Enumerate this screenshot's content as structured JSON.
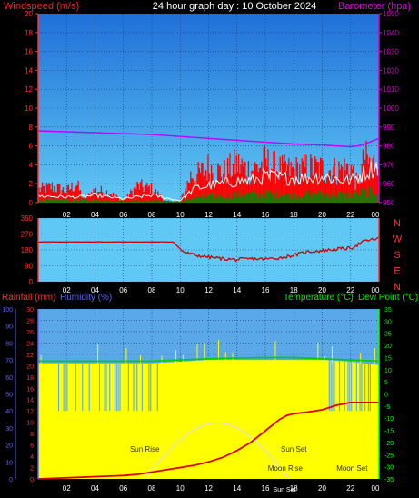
{
  "header": {
    "left_label": "Windspeed (m/s)",
    "title": "24 hour graph day : 10 October 2024",
    "right_label": "Barometer (hpa)"
  },
  "colors": {
    "wind_label": "#ff2020",
    "title": "#ffffff",
    "baro_label": "#e000e0",
    "tick": "#ffffff",
    "wind_axis": "#ff3030",
    "baro_axis": "#d000d0",
    "dir_axis": "#ff3030",
    "rain_axis": "#6060ff",
    "temp_axis": "#00ff00",
    "wind_bg_top": "#2070d8",
    "wind_bg_bottom": "#60c8f4",
    "lower_bg": "#5aa8e8",
    "grid": "#1a3a70",
    "wind_series": "#ff0000",
    "avg_series": "#ffffff",
    "green_series": "#008800",
    "baro_series": "#c000ff",
    "dir_series": "#cc0000",
    "humidity_fill": "#ffff00",
    "temp_series": "#00cc00",
    "rain_series": "#dd0000",
    "sun_curve": "#dddddd",
    "event_label": "#333300"
  },
  "chart_data": [
    {
      "type": "line",
      "title": "24 hour graph day : 10 October 2024",
      "ylabel": "Windspeed (m/s)",
      "y2label": "Barometer (hpa)",
      "x_ticks": [
        "02",
        "04",
        "06",
        "08",
        "10",
        "12",
        "14",
        "16",
        "18",
        "20",
        "22",
        "00"
      ],
      "xlim": [
        0,
        24
      ],
      "ylim": [
        0,
        20
      ],
      "y_ticks": [
        0,
        2,
        4,
        6,
        8,
        10,
        12,
        14,
        16,
        18,
        20
      ],
      "y2lim": [
        950,
        1050
      ],
      "y2_ticks": [
        950,
        960,
        970,
        980,
        990,
        1000,
        1010,
        1020,
        1030,
        1040,
        1050
      ],
      "grid": true,
      "series": [
        {
          "role": "gust",
          "x": [
            0,
            1,
            2,
            2.7,
            3.2,
            4,
            5,
            6,
            7,
            8,
            9,
            10,
            10.8,
            11,
            12,
            13,
            14,
            15,
            16,
            17,
            18,
            19,
            20,
            21,
            22,
            22.5,
            23,
            23.5,
            24
          ],
          "y": [
            2,
            2.5,
            1.8,
            3,
            0.5,
            2,
            1.6,
            0.3,
            2.6,
            2.2,
            0.2,
            0.2,
            4.5,
            4,
            5.5,
            4.6,
            6,
            5,
            6.3,
            5.2,
            5,
            5.5,
            5.3,
            5,
            5.6,
            2.7,
            7,
            5.5,
            8
          ]
        },
        {
          "role": "average",
          "x": [
            0,
            2,
            3,
            4,
            6,
            8,
            10,
            11,
            12,
            13,
            14,
            15,
            16,
            17,
            18,
            19,
            20,
            21,
            22,
            23,
            24
          ],
          "y": [
            0.7,
            0.6,
            0.6,
            0.8,
            0.4,
            0.8,
            0.2,
            1.5,
            1.8,
            2,
            2.3,
            2.3,
            2.8,
            2.6,
            2.6,
            2.6,
            2.8,
            2.5,
            2.3,
            3.2,
            4
          ]
        },
        {
          "role": "wind",
          "x": [
            0,
            2,
            4,
            6,
            8,
            10,
            11,
            12,
            14,
            16,
            18,
            20,
            22,
            23,
            24
          ],
          "y": [
            0.3,
            0.4,
            0.3,
            0.2,
            0.3,
            0.1,
            0.6,
            0.8,
            1,
            1.1,
            1,
            1.1,
            1,
            1.3,
            1.5
          ]
        },
        {
          "role": "barometer",
          "axis": "y2",
          "x": [
            0,
            2,
            4,
            6,
            8,
            10,
            12,
            14,
            16,
            18,
            20,
            21,
            22,
            22.5,
            23,
            24
          ],
          "y": [
            988,
            987.5,
            987,
            986.5,
            986,
            985,
            984,
            983,
            982,
            981,
            980.5,
            980,
            979.5,
            980,
            981,
            984
          ]
        }
      ]
    },
    {
      "type": "line",
      "right_labels": [
        "N",
        "W",
        "S",
        "E",
        "N"
      ],
      "xlim": [
        0,
        24
      ],
      "ylim": [
        0,
        360
      ],
      "y_ticks": [
        0,
        90,
        180,
        270,
        360
      ],
      "x_ticks": [
        "02",
        "04",
        "06",
        "08",
        "10",
        "12",
        "14",
        "16",
        "18",
        "20",
        "22",
        "00"
      ],
      "grid": true,
      "series": [
        {
          "role": "direction",
          "x": [
            0,
            2,
            4,
            6,
            8,
            9.5,
            10.2,
            11,
            12,
            13,
            14,
            15,
            16,
            17,
            18,
            19,
            20,
            21,
            22,
            23,
            24
          ],
          "y": [
            225,
            225,
            225,
            225,
            225,
            225,
            170,
            150,
            140,
            130,
            125,
            130,
            128,
            135,
            150,
            170,
            175,
            185,
            190,
            230,
            245
          ]
        }
      ]
    },
    {
      "type": "area",
      "left_labels": [
        "Rainfall (mm)",
        "Humidity (%)"
      ],
      "right_labels": [
        "Temperature (°C)",
        "Dew Point (°C)"
      ],
      "xlim": [
        0,
        24
      ],
      "x_ticks": [
        "02",
        "04",
        "06",
        "08",
        "10",
        "12",
        "14",
        "16",
        "18",
        "20",
        "22",
        "00"
      ],
      "humidity_axis": {
        "min": 0,
        "max": 100,
        "ticks": [
          0,
          10,
          20,
          30,
          40,
          50,
          60,
          70,
          80,
          90,
          100
        ]
      },
      "rain_axis": {
        "min": 0,
        "max": 30,
        "ticks": [
          0,
          2,
          4,
          6,
          8,
          10,
          12,
          14,
          16,
          18,
          20,
          22,
          24,
          26,
          28,
          30
        ]
      },
      "temp_axis": {
        "min": -35,
        "max": 35,
        "ticks": [
          -35,
          -30,
          -25,
          -20,
          -15,
          -10,
          -5,
          0,
          5,
          10,
          15,
          20,
          25,
          30,
          35
        ]
      },
      "grid": true,
      "series": [
        {
          "role": "humidity",
          "x": [
            0,
            2,
            4,
            6,
            8,
            10,
            12,
            14,
            16,
            18,
            20,
            22,
            24
          ],
          "y": [
            68,
            68,
            68,
            68,
            68,
            69,
            70,
            70,
            70,
            70,
            70,
            69,
            67
          ]
        },
        {
          "role": "temperature",
          "x": [
            0,
            2,
            4,
            6,
            8,
            10,
            12,
            14,
            16,
            18,
            20,
            22,
            24
          ],
          "y": [
            13.5,
            13.5,
            13.5,
            13.5,
            13.5,
            14,
            14.5,
            14.8,
            15,
            15,
            14.5,
            14,
            13.5
          ]
        },
        {
          "role": "rainfall",
          "x": [
            0,
            2,
            4,
            6,
            7,
            8,
            10,
            11,
            12,
            13,
            14,
            15,
            16,
            17,
            17.5,
            18,
            19,
            20,
            21,
            22,
            23,
            24
          ],
          "y": [
            0,
            0.2,
            0.4,
            0.6,
            0.8,
            1.2,
            2,
            2.4,
            3,
            3.8,
            5,
            6.5,
            8.5,
            10.5,
            11.2,
            11.5,
            11.8,
            12.2,
            13,
            13.5,
            13.5,
            13.5
          ]
        }
      ],
      "events": [
        {
          "label": "Sun Rise",
          "hour": 7.5
        },
        {
          "label": "Sun Set",
          "hour": 18.0
        },
        {
          "label": "Moon Rise",
          "hour": 17.4
        },
        {
          "label": "Moon Set",
          "hour": 22.1
        }
      ],
      "sun_curve": {
        "rise_hour": 7.5,
        "set_hour": 17.7,
        "peak_humidity": 33
      },
      "bottom_event_label": "Sun Set"
    }
  ]
}
